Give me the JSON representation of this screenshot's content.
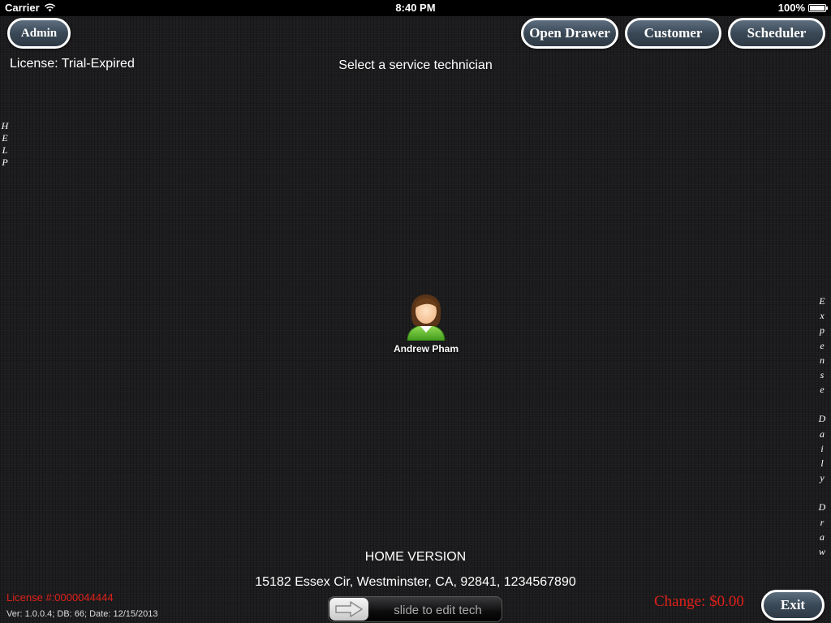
{
  "status_bar": {
    "carrier": "Carrier",
    "time": "8:40 PM",
    "battery": "100%"
  },
  "toolbar": {
    "admin_label": "Admin",
    "open_drawer_label": "Open Drawer",
    "customer_label": "Customer",
    "scheduler_label": "Scheduler"
  },
  "license_status": "License: Trial-Expired",
  "prompt": "Select a service technician",
  "side_menus": {
    "help": [
      "H",
      "E",
      "L",
      "P"
    ],
    "expense": [
      "E",
      "x",
      "p",
      "e",
      "n",
      "s",
      "e"
    ],
    "daily": [
      "D",
      "a",
      "i",
      "l",
      "y"
    ],
    "draw": [
      "D",
      "r",
      "a",
      "w"
    ]
  },
  "technicians": [
    {
      "name": "Andrew Pham",
      "icon": "user-avatar-icon"
    }
  ],
  "edition": "HOME VERSION",
  "address": "15182 Essex Cir, Westminster, CA, 92841, 1234567890",
  "footer": {
    "license_number": "License #:0000044444",
    "version_info": "Ver: 1.0.0.4; DB: 66; Date: 12/15/2013",
    "change": "Change: $0.00",
    "exit_label": "Exit",
    "slider_label": "slide to edit tech",
    "slider_icon": "arrow-right-icon"
  },
  "colors": {
    "alert_red": "#e0201a",
    "button_fill": "#3a4856",
    "background": "#1c1c1e"
  }
}
